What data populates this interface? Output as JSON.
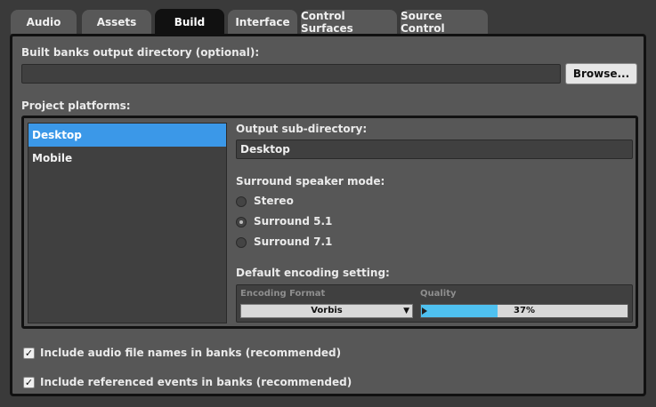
{
  "tabs": [
    {
      "label": "Audio",
      "active": false
    },
    {
      "label": "Assets",
      "active": false
    },
    {
      "label": "Build",
      "active": true
    },
    {
      "label": "Interface",
      "active": false
    },
    {
      "label": "Control Surfaces",
      "active": false
    },
    {
      "label": "Source Control",
      "active": false
    }
  ],
  "build": {
    "output_dir_label": "Built banks output directory (optional):",
    "output_dir_value": "",
    "browse_label": "Browse...",
    "platforms_label": "Project platforms:",
    "platforms": [
      {
        "name": "Desktop",
        "selected": true
      },
      {
        "name": "Mobile",
        "selected": false
      }
    ],
    "subdir_label": "Output sub-directory:",
    "subdir_value": "Desktop",
    "surround_label": "Surround speaker mode:",
    "surround_options": [
      {
        "label": "Stereo",
        "selected": false
      },
      {
        "label": "Surround 5.1",
        "selected": true
      },
      {
        "label": "Surround 7.1",
        "selected": false
      }
    ],
    "encoding_label": "Default encoding setting:",
    "encoding_format_header": "Encoding Format",
    "encoding_format_value": "Vorbis",
    "quality_header": "Quality",
    "quality_text": "37%",
    "quality_fraction": 0.37,
    "checkboxes": [
      {
        "label": "Include audio file names in banks (recommended)",
        "checked": true
      },
      {
        "label": "Include referenced events in banks (recommended)",
        "checked": true
      }
    ]
  },
  "colors": {
    "selection": "#3b98e8",
    "quality_fill": "#4fc1f0"
  }
}
